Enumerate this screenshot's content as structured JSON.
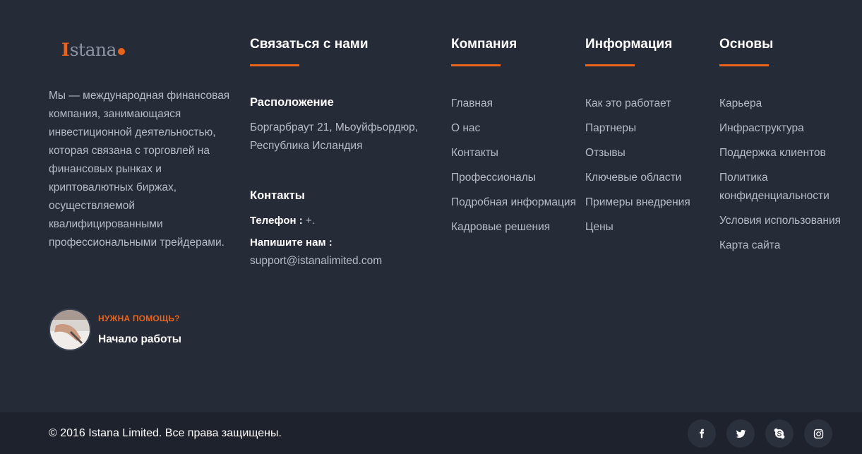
{
  "brand": {
    "logo_mark": "I",
    "logo_text": "stana",
    "accent_color": "#e8641c"
  },
  "about": {
    "text": "Мы — международная финансовая компания, занимающаяся инвестиционной деятельностью, которая связана с торговлей на финансовых рынках и криптовалютных биржах, осуществляемой квалифицированными профессиональными трейдерами.",
    "help_label": "НУЖНА ПОМОЩЬ?",
    "help_link": "Начало работы"
  },
  "contact": {
    "title": "Связаться с нами",
    "location_title": "Расположение",
    "address": "Боргарбраут 21, Мьоуйфьордюр, Республика Исландия",
    "contacts_title": "Контакты",
    "phone_label": "Телефон :",
    "phone_value": "+.",
    "email_label": "Напишите нам :",
    "email_value": "support@istanalimited.com"
  },
  "company": {
    "title": "Компания",
    "links": [
      "Главная",
      "О нас",
      "Контакты",
      "Профессионалы",
      "Подробная информация",
      "Кадровые решения"
    ]
  },
  "information": {
    "title": "Информация",
    "links": [
      "Как это работает",
      "Партнеры",
      "Отзывы",
      "Ключевые области",
      "Примеры внедрения",
      "Цены"
    ]
  },
  "basics": {
    "title": "Основы",
    "links": [
      "Карьера",
      "Инфраструктура",
      "Поддержка клиентов",
      "Политика конфиденциальности",
      "Условия использования",
      "Карта сайта"
    ]
  },
  "bottom": {
    "copyright": "© 2016 Istana Limited. Все права защищены.",
    "socials": [
      "facebook-icon",
      "twitter-icon",
      "skype-icon",
      "instagram-icon"
    ]
  }
}
